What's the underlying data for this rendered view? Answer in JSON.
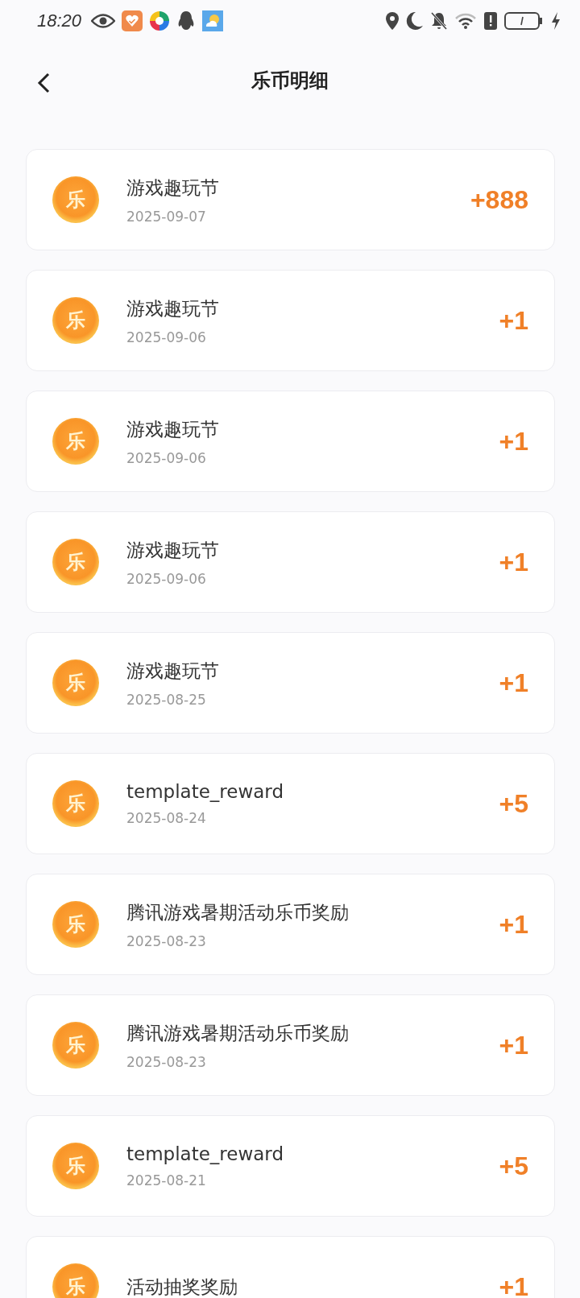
{
  "status_bar": {
    "time": "18:20"
  },
  "header": {
    "title": "乐币明细"
  },
  "records": [
    {
      "coin": "乐",
      "title": "游戏趣玩节",
      "date": "2025-09-07",
      "amount": "+888"
    },
    {
      "coin": "乐",
      "title": "游戏趣玩节",
      "date": "2025-09-06",
      "amount": "+1"
    },
    {
      "coin": "乐",
      "title": "游戏趣玩节",
      "date": "2025-09-06",
      "amount": "+1"
    },
    {
      "coin": "乐",
      "title": "游戏趣玩节",
      "date": "2025-09-06",
      "amount": "+1"
    },
    {
      "coin": "乐",
      "title": "游戏趣玩节",
      "date": "2025-08-25",
      "amount": "+1"
    },
    {
      "coin": "乐",
      "title": "template_reward",
      "date": "2025-08-24",
      "amount": "+5"
    },
    {
      "coin": "乐",
      "title": "腾讯游戏暑期活动乐币奖励",
      "date": "2025-08-23",
      "amount": "+1"
    },
    {
      "coin": "乐",
      "title": "腾讯游戏暑期活动乐币奖励",
      "date": "2025-08-23",
      "amount": "+1"
    },
    {
      "coin": "乐",
      "title": "template_reward",
      "date": "2025-08-21",
      "amount": "+5"
    },
    {
      "coin": "乐",
      "title": "活动抽奖奖励",
      "amount": "+1"
    }
  ]
}
